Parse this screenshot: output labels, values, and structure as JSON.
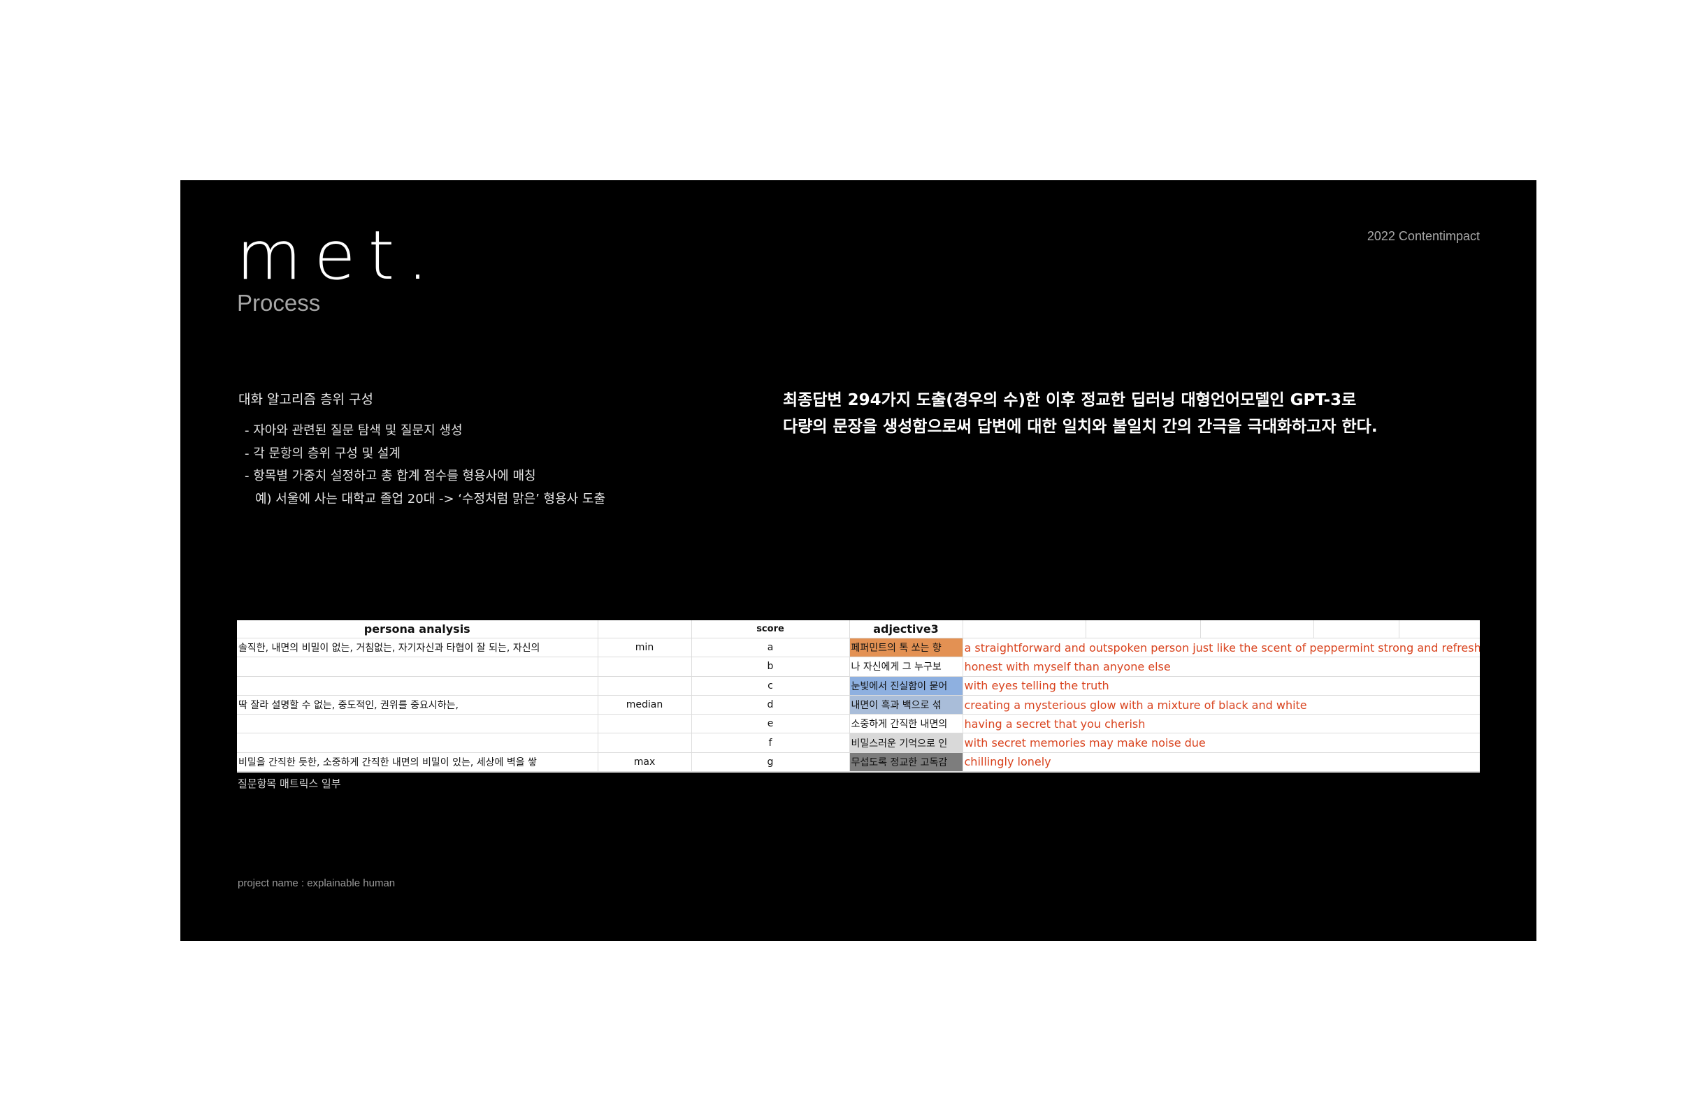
{
  "brand": {
    "logo_text": "met.",
    "subtitle": "Process",
    "year_label": "2022 Contentimpact"
  },
  "left_section": {
    "heading": "대화 알고리즘 층위 구성",
    "bullets": [
      "- 자아와 관련된 질문 탐색 및 질문지 생성",
      "- 각 문항의 층위 구성 및 설계",
      "- 항목별 가중치 설정하고 총 합계 점수를 형용사에 매칭",
      "예) 서울에 사는 대학교 졸업 20대 -> ‘수정처럼 맑은’ 형용사 도출"
    ]
  },
  "headline": {
    "line1": "최종답변 294가지 도출(경우의 수)한 이후 정교한 딥러닝 대형언어모델인 GPT-3로",
    "line2": "다량의 문장을 생성함으로써 답변에 대한 일치와 불일치 간의 간극을 극대화하고자 한다."
  },
  "table": {
    "headers": {
      "persona": "persona analysis",
      "score": "score",
      "adjective": "adjective3"
    },
    "rows": [
      {
        "persona": "솔직한, 내면의 비밀이 없는, 거침없는, 자기자신과 타협이 잘 되는, 자신의",
        "level": "min",
        "score": "a",
        "adjective": "페퍼민트의 톡 쏘는 향",
        "translation": "a straightforward and outspoken person just like the scent of peppermint strong and refreshing"
      },
      {
        "persona": "",
        "level": "",
        "score": "b",
        "adjective": "나 자신에게 그 누구보",
        "translation": "honest with myself than anyone else"
      },
      {
        "persona": "",
        "level": "",
        "score": "c",
        "adjective": "눈빛에서 진실함이 묻어",
        "translation": "with eyes telling the truth"
      },
      {
        "persona": "딱 잘라 설명할 수 없는, 중도적인, 권위를 중요시하는,",
        "level": "median",
        "score": "d",
        "adjective": "내면이 흑과 백으로 섞",
        "translation": "creating a mysterious glow with a mixture of black and white"
      },
      {
        "persona": "",
        "level": "",
        "score": "e",
        "adjective": "소중하게 간직한 내면의",
        "translation": "having a secret that you cherish"
      },
      {
        "persona": "",
        "level": "",
        "score": "f",
        "adjective": "비밀스러운 기억으로 인",
        "translation": "with secret memories may make noise due"
      },
      {
        "persona": "비밀을 간직한 듯한, 소중하게 간직한 내면의 비밀이 있는, 세상에 벽을 쌓",
        "level": "max",
        "score": "g",
        "adjective": "무섭도록 정교한 고독감",
        "translation": "chillingly lonely"
      }
    ],
    "adjective_colors": [
      "#e39153",
      "#ffffff",
      "#8eb0e0",
      "#a9bdd9",
      "#ffffff",
      "#d9d9d9",
      "#7d7d7d"
    ],
    "caption": "질문항목 매트릭스 일부"
  },
  "footer": {
    "project_label": "project name : explainable human"
  }
}
